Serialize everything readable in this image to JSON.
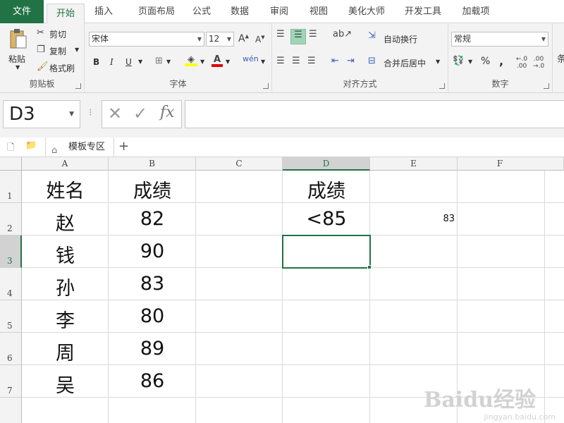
{
  "tabs": [
    "文件",
    "开始",
    "插入",
    "页面布局",
    "公式",
    "数据",
    "审阅",
    "视图",
    "美化大师",
    "开发工具",
    "加载项"
  ],
  "ribbon": {
    "clipboard": {
      "label": "剪贴板",
      "paste": "粘贴",
      "cut": "剪切",
      "copy": "复制",
      "format_painter": "格式刷"
    },
    "font": {
      "label": "字体",
      "font_name": "宋体",
      "font_size": "12",
      "bold": "B",
      "italic": "I",
      "underline": "U"
    },
    "alignment": {
      "label": "对齐方式",
      "wrap_text": "自动换行",
      "merge_center": "合并后居中"
    },
    "number": {
      "label": "数字",
      "format": "常规",
      "percent": "%",
      "comma": ","
    }
  },
  "formula_bar": {
    "name_box": "D3",
    "formula": ""
  },
  "workbook_tab": "模板专区",
  "columns": [
    "A",
    "B",
    "C",
    "D",
    "E",
    "F"
  ],
  "rows": [
    "1",
    "2",
    "3",
    "4",
    "5",
    "6",
    "7"
  ],
  "cells": {
    "A1": "姓名",
    "B1": "成绩",
    "D1": "成绩",
    "A2": "赵",
    "B2": "82",
    "D2": "<85",
    "E2": "83",
    "A3": "钱",
    "B3": "90",
    "A4": "孙",
    "B4": "83",
    "A5": "李",
    "B5": "80",
    "A6": "周",
    "B6": "89",
    "A7": "吴",
    "B7": "86"
  },
  "watermark": {
    "logo": "Baidu经验",
    "url": "jingyan.baidu.com"
  },
  "colors": {
    "accent": "#217346",
    "ribbon_bg": "#f3f3f3"
  }
}
